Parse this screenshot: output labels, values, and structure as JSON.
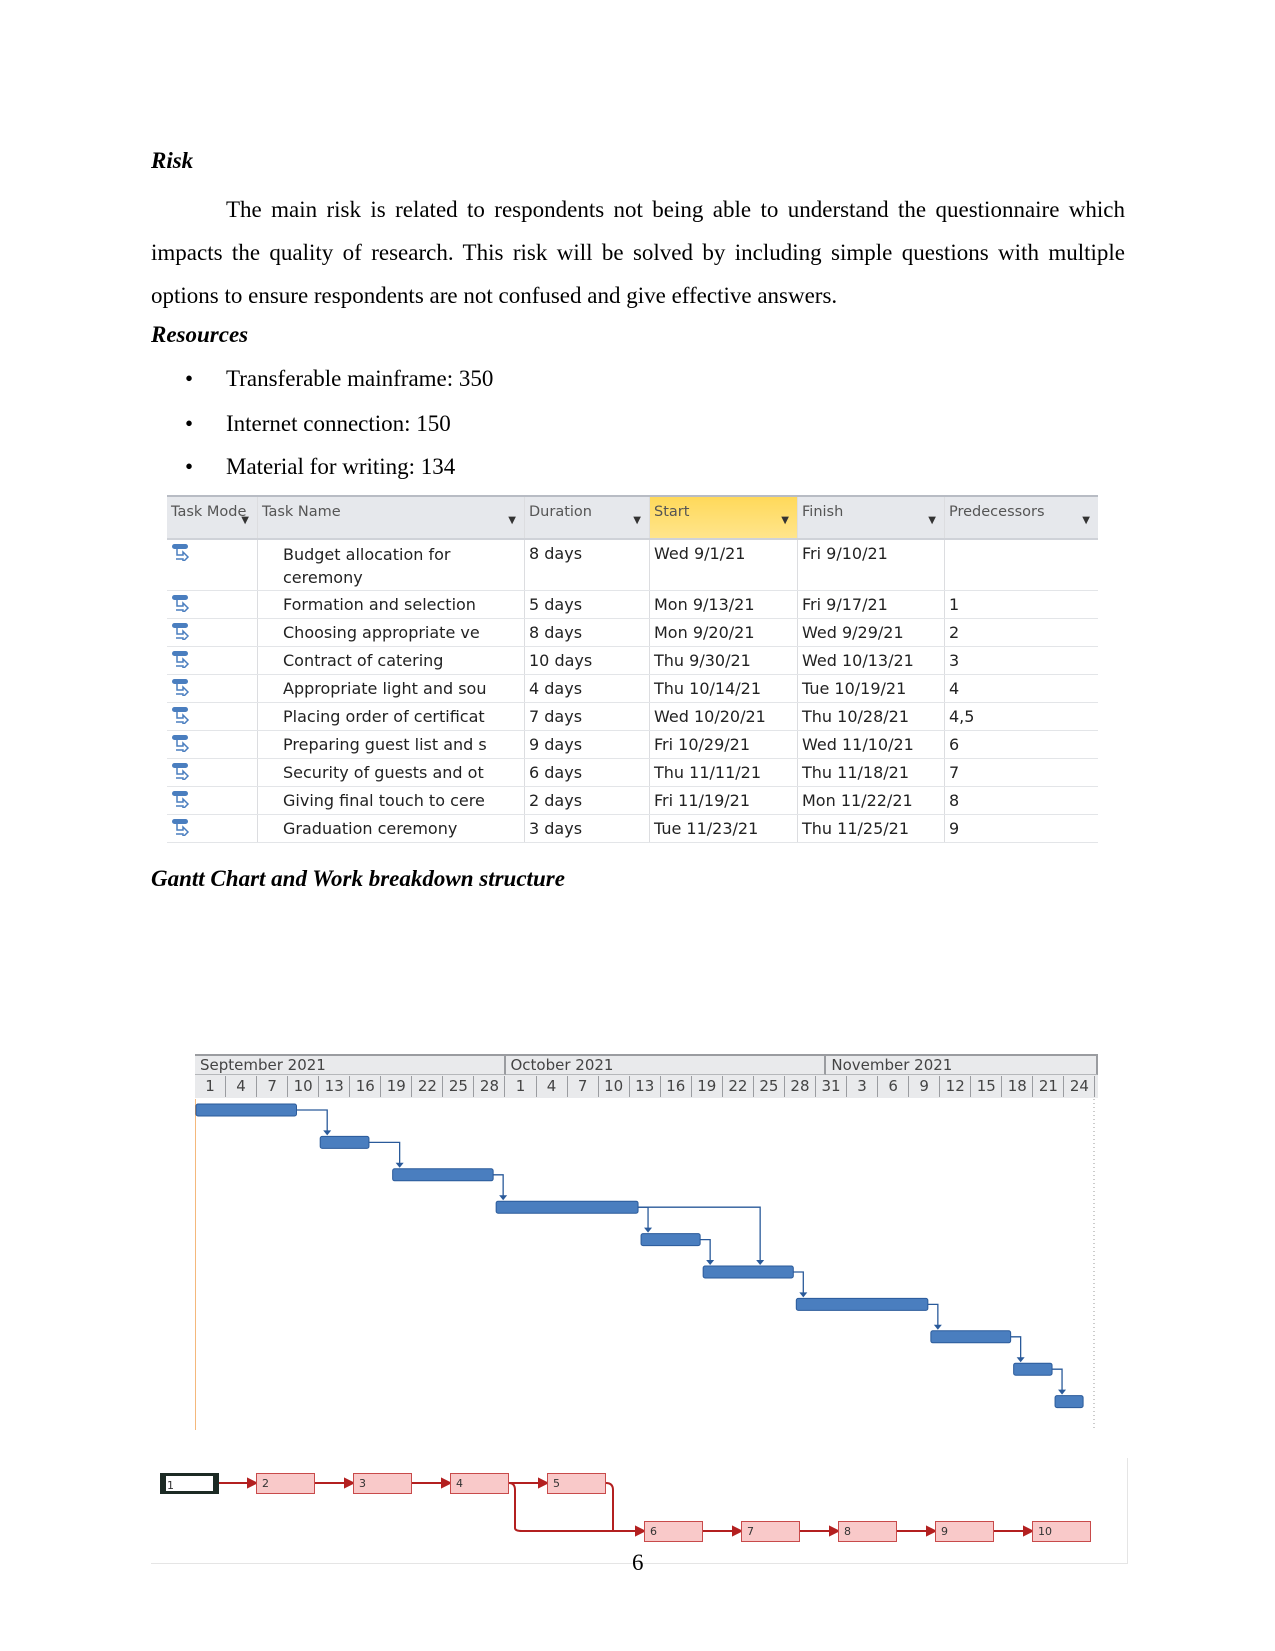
{
  "risk": {
    "heading": "Risk",
    "text": "The main risk is related to respondents not being able to understand the questionnaire which impacts the quality of research. This risk will be solved by including simple questions with multiple options to ensure respondents are not confused and give effective answers."
  },
  "resources": {
    "heading": "Resources",
    "items": [
      "Transferable mainframe: 350",
      "Internet connection: 150",
      "Material for writing: 134"
    ]
  },
  "table": {
    "headers": [
      "Task Mode",
      "Task Name",
      "Duration",
      "Start",
      "Finish",
      "Predecessors"
    ],
    "highlight_color": "#ffd95a",
    "rows": [
      {
        "name": "Budget allocation for ceremony",
        "duration": "8 days",
        "start": "Wed 9/1/21",
        "finish": "Fri 9/10/21",
        "pred": ""
      },
      {
        "name": "Formation and selection",
        "duration": "5 days",
        "start": "Mon 9/13/21",
        "finish": "Fri 9/17/21",
        "pred": "1"
      },
      {
        "name": "Choosing appropriate ve",
        "duration": "8 days",
        "start": "Mon 9/20/21",
        "finish": "Wed 9/29/21",
        "pred": "2"
      },
      {
        "name": "Contract of catering",
        "duration": "10 days",
        "start": "Thu 9/30/21",
        "finish": "Wed 10/13/21",
        "pred": "3"
      },
      {
        "name": "Appropriate light and sou",
        "duration": "4 days",
        "start": "Thu 10/14/21",
        "finish": "Tue 10/19/21",
        "pred": "4"
      },
      {
        "name": "Placing order of certificat",
        "duration": "7 days",
        "start": "Wed 10/20/21",
        "finish": "Thu 10/28/21",
        "pred": "4,5"
      },
      {
        "name": "Preparing guest list and s",
        "duration": "9 days",
        "start": "Fri 10/29/21",
        "finish": "Wed 11/10/21",
        "pred": "6"
      },
      {
        "name": "Security of guests and ot",
        "duration": "6 days",
        "start": "Thu 11/11/21",
        "finish": "Thu 11/18/21",
        "pred": "7"
      },
      {
        "name": "Giving final touch to cere",
        "duration": "2 days",
        "start": "Fri 11/19/21",
        "finish": "Mon 11/22/21",
        "pred": "8"
      },
      {
        "name": "Graduation ceremony",
        "duration": "3 days",
        "start": "Tue 11/23/21",
        "finish": "Thu 11/25/21",
        "pred": "9"
      }
    ]
  },
  "gantt_heading": "Gantt Chart and Work breakdown structure",
  "gantt": {
    "months": [
      "September 2021",
      "October 2021",
      "November 2021"
    ],
    "days": [
      "1",
      "4",
      "7",
      "10",
      "13",
      "16",
      "19",
      "22",
      "25",
      "28",
      "1",
      "4",
      "7",
      "10",
      "13",
      "16",
      "19",
      "22",
      "25",
      "28",
      "31",
      "3",
      "6",
      "9",
      "12",
      "15",
      "18",
      "21",
      "24"
    ],
    "bar_color": "#4a7ebf"
  },
  "network": {
    "nodes": [
      "1",
      "2",
      "3",
      "4",
      "5",
      "6",
      "7",
      "8",
      "9",
      "10"
    ],
    "line_color": "#b32020"
  },
  "page_number": "6"
}
